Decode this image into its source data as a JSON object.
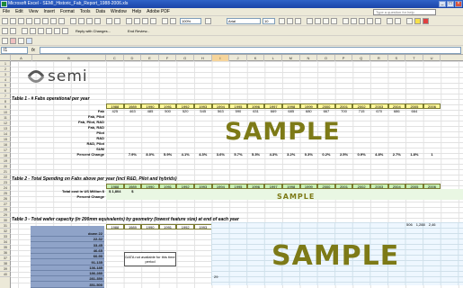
{
  "window": {
    "title": "Microsoft Excel - SEMI_Historic_Fab_Report_1988-2006.xls"
  },
  "menu": [
    "File",
    "Edit",
    "View",
    "Insert",
    "Format",
    "Tools",
    "Data",
    "Window",
    "Help",
    "Adobe PDF"
  ],
  "help_placeholder": "Type a question for help",
  "toolbar": {
    "font": "Arial",
    "font_size": "10",
    "zoom": "100%",
    "reply_label": "Reply with Changes...",
    "end_review": "End Review..."
  },
  "namebox": "I1",
  "columns": [
    "A",
    "B",
    "C",
    "D",
    "E",
    "F",
    "G",
    "H",
    "I",
    "J",
    "K",
    "L",
    "M",
    "N",
    "O",
    "P",
    "Q",
    "R",
    "S",
    "T",
    "U"
  ],
  "selected_column": "I",
  "rows": [
    "1",
    "2",
    "3",
    "4",
    "5",
    "6",
    "7",
    "8",
    "9",
    "10",
    "11",
    "12",
    "13",
    "14",
    "15",
    "16",
    "17",
    "18",
    "19",
    "20",
    "21",
    "22",
    "23",
    "24",
    "25",
    "26",
    "27",
    "28",
    "29",
    "30",
    "31",
    "32",
    "33",
    "34",
    "35",
    "36",
    "37",
    "38",
    "39",
    "40"
  ],
  "logo": {
    "text": "semi"
  },
  "years": [
    "1988",
    "1989",
    "1990",
    "1991",
    "1992",
    "1993",
    "1994",
    "1995",
    "1996",
    "1997",
    "1998",
    "1999",
    "2000",
    "2001",
    "2002",
    "2003",
    "2004",
    "2005",
    "2006"
  ],
  "table1": {
    "title": "Table 1 - # Fabs operational per year",
    "labels": [
      "Fab",
      "Fab, Pilot",
      "Fab, Pilot, R&D",
      "Fab, R&D",
      "Pilot",
      "R&D",
      "R&D, Pilot",
      "SUM",
      "Percent Change"
    ],
    "fab_values": [
      "425",
      "463",
      "485",
      "500",
      "520",
      "545",
      "563",
      "590",
      "631",
      "669",
      "685",
      "680",
      "667",
      "700",
      "715",
      "670",
      "686",
      "664",
      ""
    ],
    "percent_change": [
      "",
      "7.9%",
      "8.0%",
      "5.9%",
      "4.1%",
      "4.3%",
      "3.6%",
      "5.7%",
      "5.3%",
      "4.3%",
      "3.2%",
      "0.3%",
      "0.2%",
      "2.5%",
      "0.9%",
      "4.8%",
      "2.7%",
      "1.8%",
      "1"
    ]
  },
  "table2": {
    "title": "Table 2 - Total Spending on Fabs above per year (incl R&D, Pilot and hybrids)",
    "labels": [
      "Total cost in US Million $",
      "Percent Change"
    ],
    "first_values": [
      "$ 1,804",
      "$"
    ]
  },
  "table3": {
    "title": "Table 3 - Total wafer capacity (in 200mm equivalents) by geometry (lowest feature size) at end of each year",
    "sizes": [
      "down 22",
      "22-32",
      "33-45",
      "46-65",
      "66-90",
      "91-135",
      "136-185",
      "186-280",
      "281-350",
      "351-500"
    ],
    "na_note": "DATA not available for this time period",
    "first_value": "29",
    "top_right_values": [
      "506",
      "1,288",
      "2,46"
    ]
  },
  "sample_texts": [
    "SAMPLE",
    "SAMPLE",
    "SAMPLE"
  ]
}
